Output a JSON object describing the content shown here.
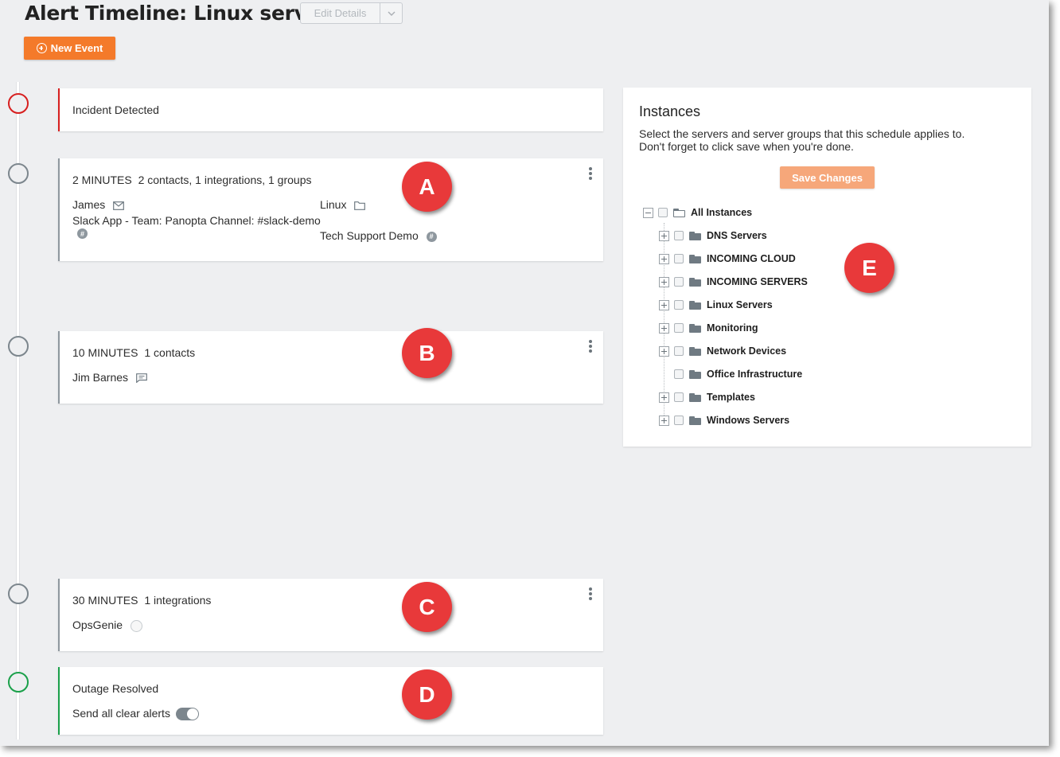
{
  "header": {
    "title": "Alert Timeline: Linux servers",
    "edit_label": "Edit Details",
    "new_event_label": "New Event"
  },
  "timeline": {
    "incident": {
      "label": "Incident Detected"
    },
    "step_a": {
      "time": "2 MINUTES",
      "summary": "2 contacts, 1 integrations, 1 groups",
      "items": {
        "james": "James",
        "linux": "Linux",
        "slack": "Slack App - Team: Panopta Channel: #slack-demo",
        "tech_support": "Tech Support Demo"
      }
    },
    "step_b": {
      "time": "10 MINUTES",
      "summary": "1 contacts",
      "items": {
        "jim": "Jim Barnes"
      }
    },
    "step_c": {
      "time": "30 MINUTES",
      "summary": "1 integrations",
      "items": {
        "opsgenie": "OpsGenie"
      }
    },
    "resolved": {
      "label": "Outage Resolved",
      "toggle_label": "Send all clear alerts",
      "toggle_on": true
    }
  },
  "annotations": {
    "a": "A",
    "b": "B",
    "c": "C",
    "d": "D",
    "e": "E"
  },
  "instances": {
    "title": "Instances",
    "desc_line1": "Select the servers and server groups that this schedule applies to.",
    "desc_line2": "Don't forget to click save when you're done.",
    "save_label": "Save Changes",
    "root": "All Instances",
    "groups": [
      "DNS Servers",
      "INCOMING CLOUD",
      "INCOMING SERVERS",
      "Linux Servers",
      "Monitoring",
      "Network Devices",
      "Office Infrastructure",
      "Templates",
      "Windows Servers"
    ]
  },
  "colors": {
    "accent": "#f47a2a",
    "incident": "#d71f1f",
    "resolved": "#1aa04a",
    "annotation": "#e8393a"
  }
}
